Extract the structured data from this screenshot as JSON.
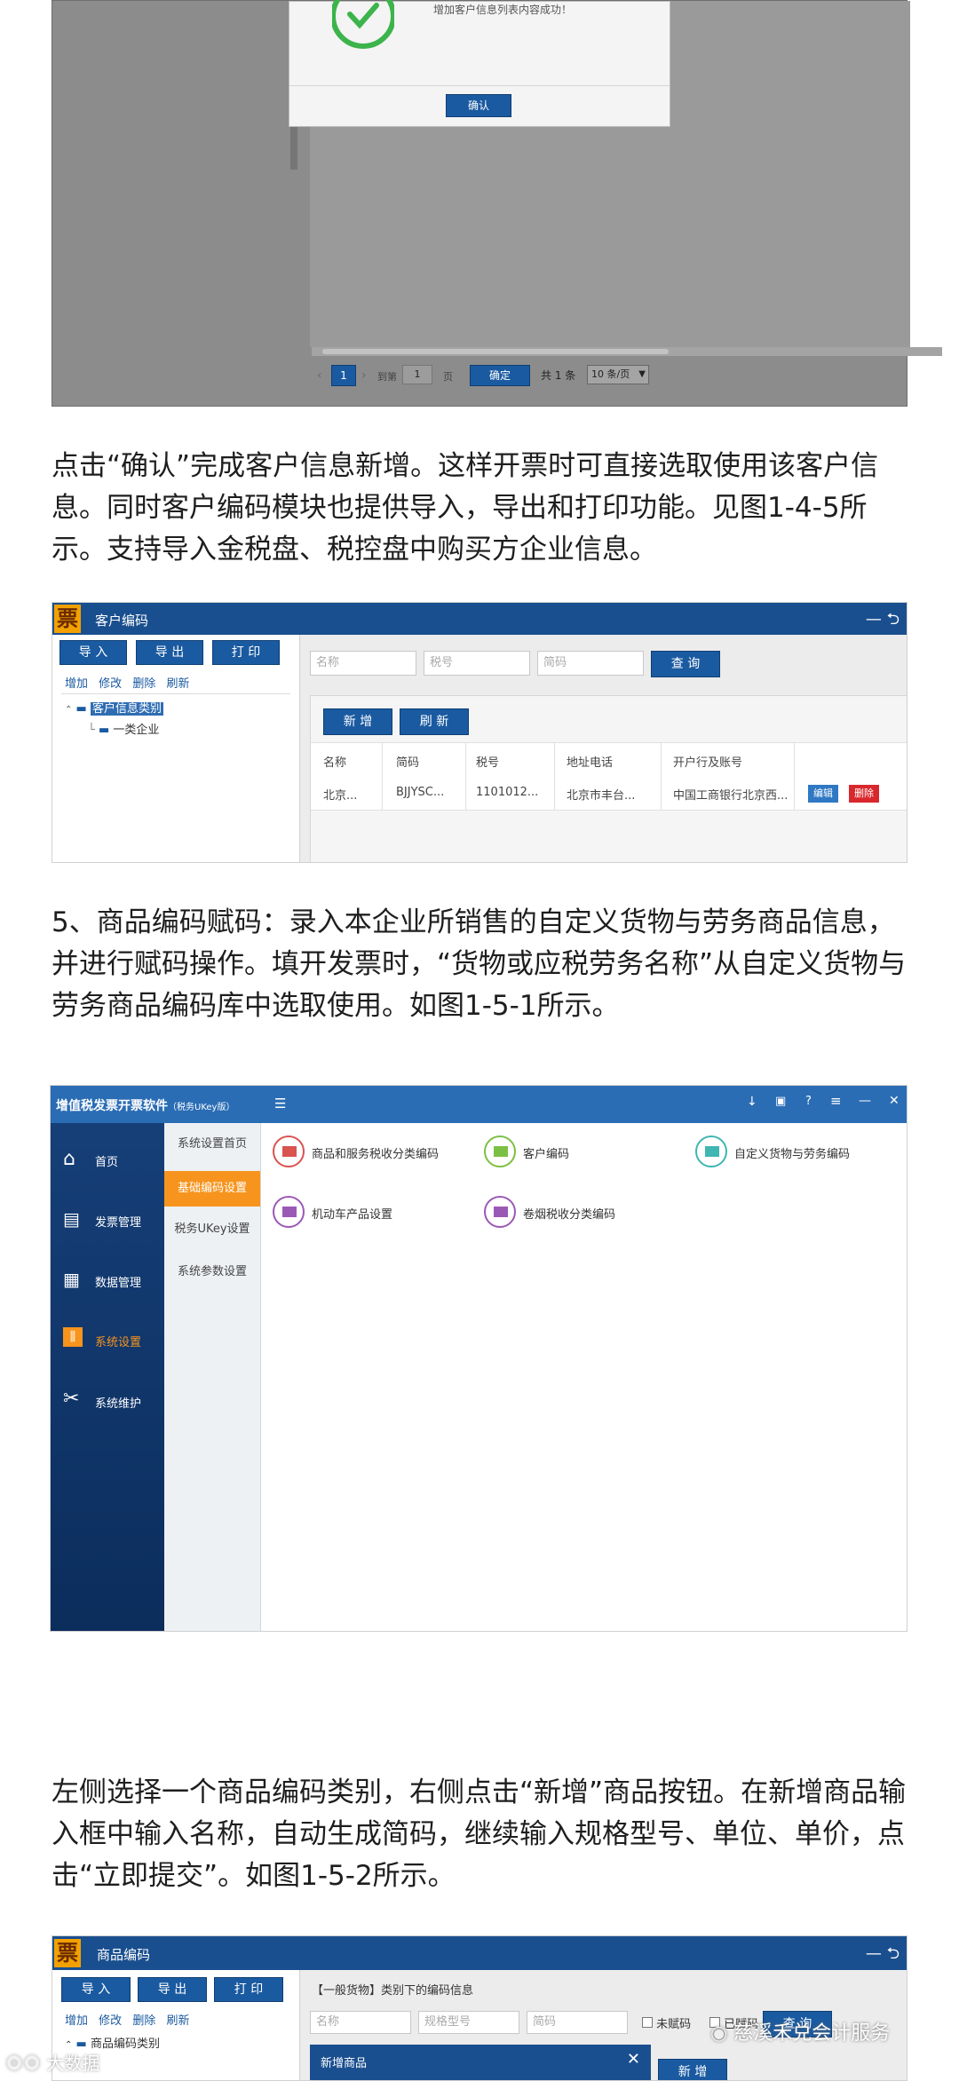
{
  "success_dialog": {
    "message": "增加客户信息列表内容成功！",
    "confirm_label": "确认"
  },
  "pager1": {
    "current_page": "1",
    "goto_label": "到第",
    "page_input": "1",
    "page_unit": "页",
    "ok_label": "确定",
    "total": "共 1 条",
    "per_page": "10 条/页"
  },
  "para1": "点击“确认”完成客户信息新增。这样开票时可直接选取使用该客户信息。同时客户编码模块也提供导入，导出和打印功能。见图1-4-5所示。支持导入金税盘、税控盘中购买方企业信息。",
  "customer_window": {
    "logo": "票",
    "title": "客户编码",
    "window_controls": "— ⮌",
    "toolbar": [
      "导 入",
      "导 出",
      "打 印"
    ],
    "links": [
      "增加",
      "修改",
      "删除",
      "刷新"
    ],
    "tree_root": "客户信息类别",
    "tree_child": "一类企业",
    "search_placeholders": [
      "名称",
      "税号",
      "简码"
    ],
    "search_button": "查 询",
    "add_button": "新 增",
    "refresh_button": "刷 新",
    "columns": [
      "名称",
      "简码",
      "税号",
      "地址电话",
      "开户行及账号"
    ],
    "row": [
      "北京...",
      "BJJYSC...",
      "1101012...",
      "北京市丰台...",
      "中国工商银行北京西..."
    ],
    "edit_label": "编辑",
    "delete_label": "删除"
  },
  "para2": "5、商品编码赋码：录入本企业所销售的自定义货物与劳务商品信息，并进行赋码操作。填开发票时，“货物或应税劳务名称”从自定义货物与劳务商品编码库中选取使用。如图1-5-1所示。",
  "main_app": {
    "title": "增值税发票开票软件",
    "title_tag": "（税务UKey版）",
    "menu_icon": "☰",
    "header_controls": [
      "↓",
      "▣",
      "?",
      "≡",
      "—",
      "✕"
    ],
    "sidebar": [
      "首页",
      "发票管理",
      "数据管理",
      "系统设置",
      "系统维护"
    ],
    "subnav": [
      "系统设置首页",
      "基础编码设置",
      "税务UKey设置",
      "系统参数设置"
    ],
    "tiles": [
      "商品和服务税收分类编码",
      "客户编码",
      "自定义货物与劳务编码",
      "机动车产品设置",
      "卷烟税收分类编码"
    ],
    "accent_orange": "#f7941d",
    "sidebar_blue": "#0f3f7a"
  },
  "para3": "左侧选择一个商品编码类别，右侧点击“新增”商品按钮。在新增商品输入框中输入名称，自动生成简码，继续输入规格型号、单位、单价，点击“立即提交”。如图1-5-2所示。",
  "product_window": {
    "logo": "票",
    "title": "商品编码",
    "window_controls": "— ⮌",
    "toolbar": [
      "导 入",
      "导 出",
      "打 印"
    ],
    "links": [
      "增加",
      "修改",
      "删除",
      "刷新"
    ],
    "category_caption": "【一般货物】类别下的编码信息",
    "tree_root": "商品编码类别",
    "search_placeholders": [
      "名称",
      "规格型号",
      "简码"
    ],
    "checkbox_uncoded": "未赋码",
    "checkbox_coded": "已赋码",
    "search_button": "查 询",
    "add_button": "新 增",
    "dialog_title": "新增商品",
    "dialog_close": "✕"
  },
  "watermarks": {
    "left": "大数据",
    "right": "慈溪禾兑会计服务"
  }
}
